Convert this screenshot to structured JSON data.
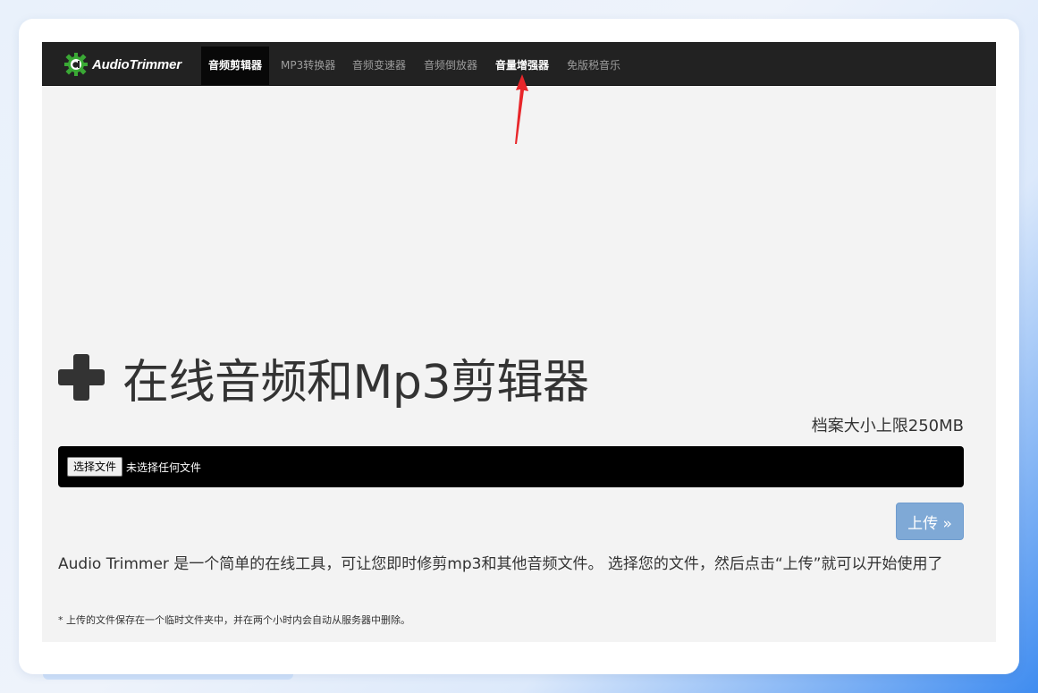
{
  "brand": {
    "name": "AudioTrimmer",
    "logo_icon": "green-gear-a-logo-icon"
  },
  "nav": {
    "items": [
      {
        "label": "音频剪辑器",
        "state": "active"
      },
      {
        "label": "MP3转换器",
        "state": "normal"
      },
      {
        "label": "音频变速器",
        "state": "normal"
      },
      {
        "label": "音频倒放器",
        "state": "normal"
      },
      {
        "label": "音量增强器",
        "state": "highlighted"
      },
      {
        "label": "免版税音乐",
        "state": "normal"
      }
    ]
  },
  "annotation": {
    "icon": "red-arrow-icon",
    "color": "#e8262a"
  },
  "hero": {
    "icon": "plus-icon",
    "title": "在线音频和Mp3剪辑器"
  },
  "upload": {
    "size_limit": "档案大小上限250MB",
    "choose_file_label": "选择文件",
    "file_status": "未选择任何文件",
    "upload_label": "上传 »"
  },
  "description": "Audio Trimmer 是一个简单的在线工具，可让您即时修剪mp3和其他音频文件。 选择您的文件，然后点击“上传”就可以开始使用了",
  "note": "* 上传的文件保存在一个临时文件夹中，并在两个小时内会自动从服务器中删除。",
  "colors": {
    "navbar_bg": "#222222",
    "page_bg": "#f3f3f3",
    "upload_button": "#7fa9d6",
    "file_bar": "#000000",
    "logo_green": "#3aa935"
  }
}
